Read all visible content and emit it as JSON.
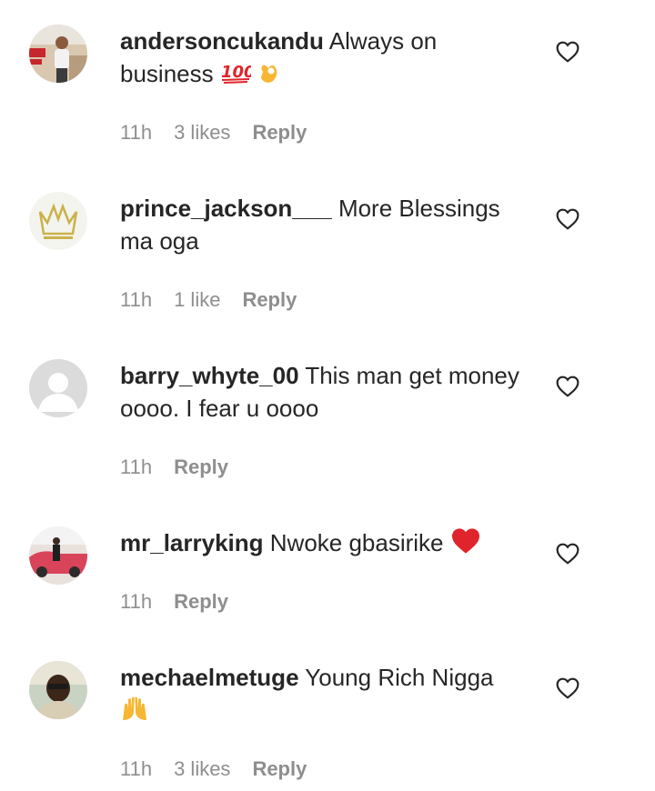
{
  "comments": [
    {
      "username": "andersoncukandu",
      "text": "Always on business",
      "emojis": [
        "hundred-points",
        "ok-hand"
      ],
      "time": "11h",
      "likes": "3 likes",
      "reply": "Reply",
      "avatar": "profile-photo"
    },
    {
      "username": "prince_jackson___",
      "text": "More Blessings ma oga",
      "emojis": [],
      "time": "11h",
      "likes": "1 like",
      "reply": "Reply",
      "avatar": "crown-logo"
    },
    {
      "username": "barry_whyte_00",
      "text": "This man get money oooo. I fear u oooo",
      "emojis": [],
      "time": "11h",
      "likes": "",
      "reply": "Reply",
      "avatar": "default-avatar"
    },
    {
      "username": "mr_larryking",
      "text": "Nwoke gbasirike",
      "emojis": [
        "red-heart"
      ],
      "time": "11h",
      "likes": "",
      "reply": "Reply",
      "avatar": "profile-photo"
    },
    {
      "username": "mechaelmetuge",
      "text": "Young Rich Nigga",
      "emojis": [
        "raising-hands"
      ],
      "time": "11h",
      "likes": "3 likes",
      "reply": "Reply",
      "avatar": "profile-photo"
    }
  ],
  "colors": {
    "text": "#262626",
    "meta": "#8e8e8e",
    "heart_outline": "#262626"
  },
  "icons": {
    "like": "heart-outline-icon"
  }
}
